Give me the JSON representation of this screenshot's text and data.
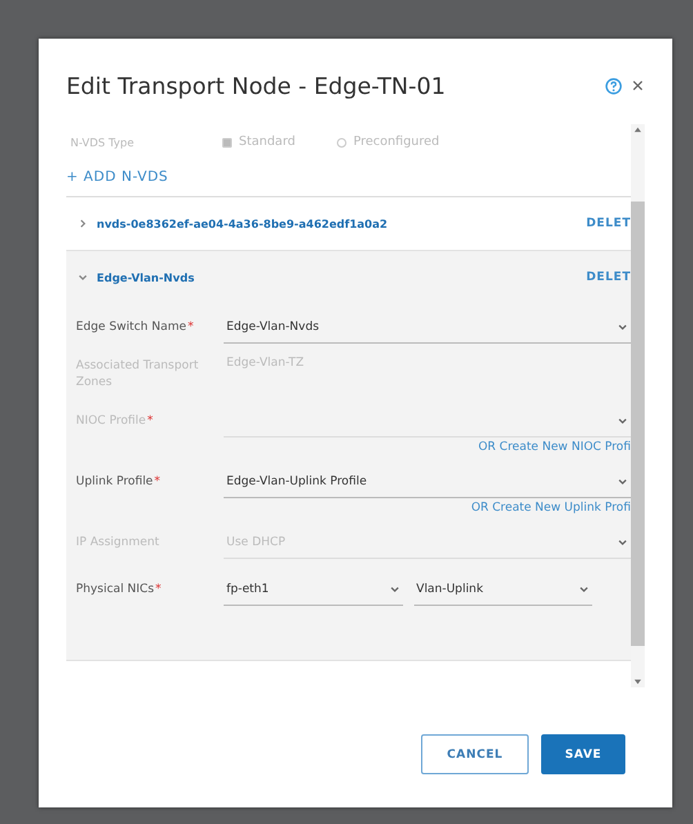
{
  "dialog": {
    "title": "Edit Transport Node - Edge-TN-01",
    "nvds_type": {
      "label": "N-VDS Type",
      "disabled": true,
      "options": [
        {
          "label": "Standard",
          "selected": true
        },
        {
          "label": "Preconfigured",
          "selected": false
        }
      ]
    },
    "add_link": "+ ADD N-VDS",
    "switches": [
      {
        "name": "nvds-0e8362ef-ae04-4a36-8be9-a462edf1a0a2",
        "expanded": false,
        "delete": "DELET"
      },
      {
        "name": "Edge-Vlan-Nvds",
        "expanded": true,
        "delete": "DELET",
        "fields": [
          {
            "kind": "select",
            "label": "Edge Switch Name",
            "required_mark": "*",
            "disabled": false,
            "value": "Edge-Vlan-Nvds"
          },
          {
            "kind": "static",
            "label": "Associated Transport Zones",
            "disabled": true,
            "value": "Edge-Vlan-TZ"
          },
          {
            "kind": "select",
            "label": "NIOC Profile",
            "required_mark": "*",
            "disabled": true
          },
          {
            "kind": "link",
            "text": "OR Create New NIOC Profi"
          },
          {
            "kind": "select",
            "label": "Uplink Profile",
            "required_mark": "*",
            "disabled": false,
            "value": "Edge-Vlan-Uplink Profile"
          },
          {
            "kind": "link",
            "text": "OR Create New Uplink Profi"
          },
          {
            "kind": "select",
            "label": "IP Assignment",
            "disabled": true,
            "value": "Use DHCP"
          },
          {
            "kind": "pair",
            "label": "Physical NICs",
            "required_mark": "*",
            "disabled": false,
            "values": [
              "fp-eth1",
              "Vlan-Uplink"
            ]
          }
        ]
      }
    ],
    "buttons": [
      {
        "label": "CANCEL",
        "kind": "secondary"
      },
      {
        "label": "SAVE",
        "kind": "primary"
      }
    ]
  }
}
